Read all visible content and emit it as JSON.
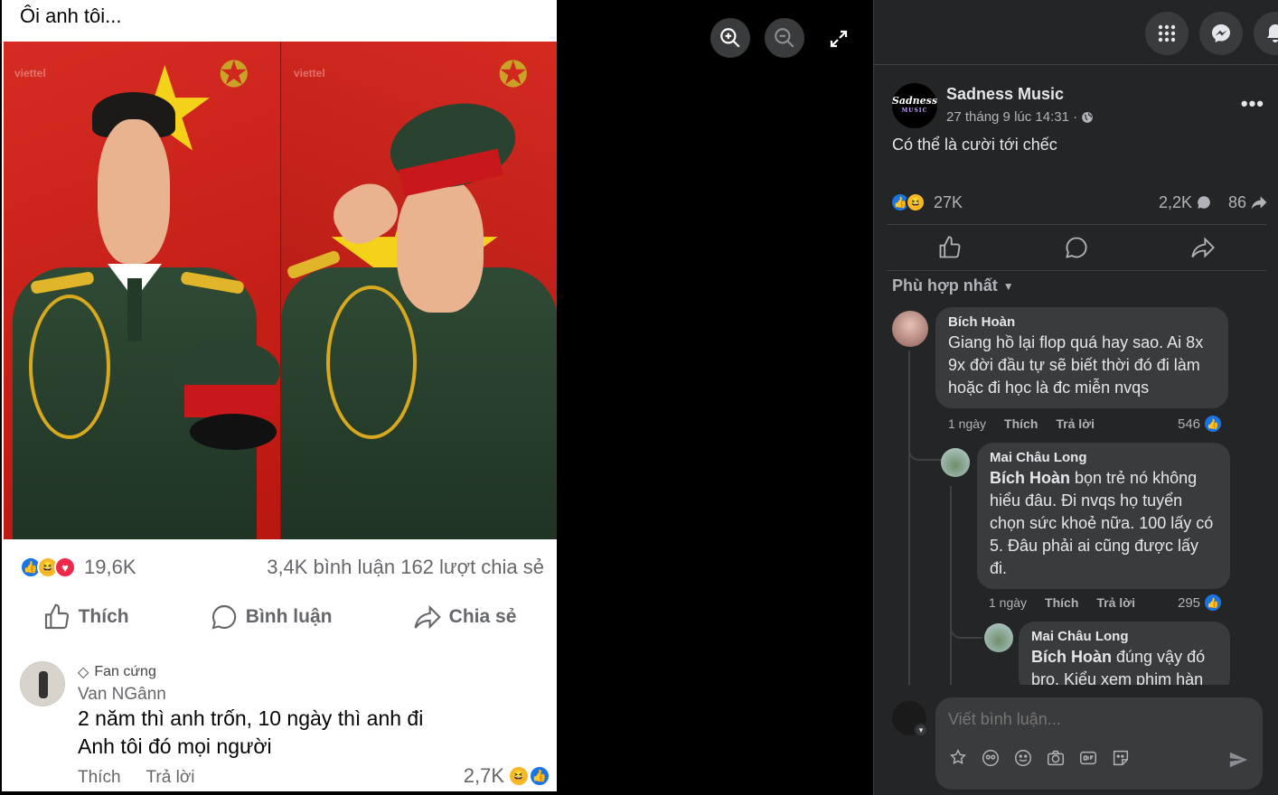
{
  "viewer": {
    "image": {
      "title": "Ôi anh tôi...",
      "watermark": "viettel",
      "reactions_count": "19,6K",
      "stats_right": "3,4K bình luận  162 lượt chia sẻ",
      "actions": {
        "like": "Thích",
        "comment": "Bình luận",
        "share": "Chia sẻ"
      },
      "comment": {
        "badge": "Fan cứng",
        "author": "Van NGânn",
        "text_line1": "2 năm thì anh trốn, 10 ngày thì anh đi",
        "text_line2": "Anh tôi đó mọi người",
        "like": "Thích",
        "reply": "Trả lời",
        "count": "2,7K"
      }
    },
    "controls": {
      "zoom_in": "zoom-in-icon",
      "zoom_out": "zoom-out-icon",
      "fullscreen": "expand-icon"
    }
  },
  "topbar": {
    "icons": [
      "grid-menu-icon",
      "messenger-icon",
      "bell-icon"
    ]
  },
  "post": {
    "page_name": "Sadness Music",
    "avatar_text": "Sadness",
    "avatar_sub": "MUSIC",
    "time": "27 tháng 9 lúc 14:31 ·",
    "text": "Có thể là cười tới chếc",
    "reaction_count": "27K",
    "comment_count": "2,2K",
    "share_count": "86",
    "sort_label": "Phù hợp nhất"
  },
  "comments": [
    {
      "author": "Bích Hoàn",
      "text": "Giang hồ lại flop quá hay sao. Ai 8x 9x đời đầu tự sẽ biết thời đó đi làm hoặc đi học là đc miễn nvqs",
      "time": "1 ngày",
      "like": "Thích",
      "reply": "Trả lời",
      "count": "546"
    },
    {
      "author": "Mai Châu Long",
      "mention": "Bích Hoàn",
      "text": " bọn trẻ nó không hiểu đâu. Đi nvqs họ tuyển chọn sức khoẻ nữa. 100 lấy có 5. Đâu phải ai cũng được lấy đi.",
      "time": "1 ngày",
      "like": "Thích",
      "reply": "Trả lời",
      "count": "295"
    },
    {
      "author": "Mai Châu Long",
      "mention": "Bích Hoàn",
      "text": " đúng vậy đó bro. Kiểu xem phim hàn"
    }
  ],
  "composer": {
    "placeholder": "Viết bình luận..."
  },
  "colors": {
    "like_blue": "#1b74e4",
    "haha_yellow": "#f7b928",
    "love_red": "#f02849",
    "panel_bg": "#242526"
  }
}
